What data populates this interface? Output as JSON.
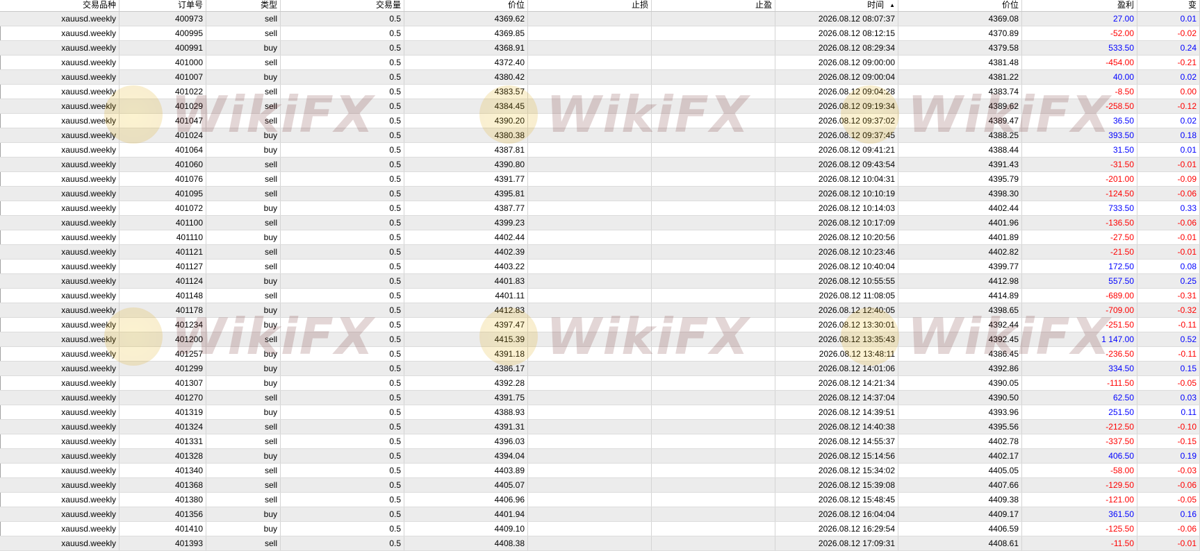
{
  "columns": [
    {
      "key": "symbol",
      "label": "交易品种"
    },
    {
      "key": "order",
      "label": "订单号"
    },
    {
      "key": "type",
      "label": "类型"
    },
    {
      "key": "volume",
      "label": "交易量"
    },
    {
      "key": "price_open",
      "label": "价位"
    },
    {
      "key": "sl",
      "label": "止损"
    },
    {
      "key": "tp",
      "label": "止盈"
    },
    {
      "key": "time",
      "label": "时间",
      "sorted": "ascending"
    },
    {
      "key": "price_close",
      "label": "价位"
    },
    {
      "key": "profit",
      "label": "盈利"
    },
    {
      "key": "change",
      "label": "变"
    }
  ],
  "sort_icon": "sort-ascending-icon",
  "colors": {
    "positive": "#0000ff",
    "negative": "#ff0000",
    "alt_row": "#ececec"
  },
  "watermark": {
    "text": "WikiFX",
    "icon": "wikifx-seal-icon"
  },
  "rows": [
    [
      "xauusd.weekly",
      "400973",
      "sell",
      "0.5",
      "4369.62",
      "",
      "",
      "2026.08.12 08:07:37",
      "4369.08",
      "27.00",
      "0.01"
    ],
    [
      "xauusd.weekly",
      "400995",
      "sell",
      "0.5",
      "4369.85",
      "",
      "",
      "2026.08.12 08:12:15",
      "4370.89",
      "-52.00",
      "-0.02"
    ],
    [
      "xauusd.weekly",
      "400991",
      "buy",
      "0.5",
      "4368.91",
      "",
      "",
      "2026.08.12 08:29:34",
      "4379.58",
      "533.50",
      "0.24"
    ],
    [
      "xauusd.weekly",
      "401000",
      "sell",
      "0.5",
      "4372.40",
      "",
      "",
      "2026.08.12 09:00:00",
      "4381.48",
      "-454.00",
      "-0.21"
    ],
    [
      "xauusd.weekly",
      "401007",
      "buy",
      "0.5",
      "4380.42",
      "",
      "",
      "2026.08.12 09:00:04",
      "4381.22",
      "40.00",
      "0.02"
    ],
    [
      "xauusd.weekly",
      "401022",
      "sell",
      "0.5",
      "4383.57",
      "",
      "",
      "2026.08.12 09:04:28",
      "4383.74",
      "-8.50",
      "0.00"
    ],
    [
      "xauusd.weekly",
      "401029",
      "sell",
      "0.5",
      "4384.45",
      "",
      "",
      "2026.08.12 09:19:34",
      "4389.62",
      "-258.50",
      "-0.12"
    ],
    [
      "xauusd.weekly",
      "401047",
      "sell",
      "0.5",
      "4390.20",
      "",
      "",
      "2026.08.12 09:37:02",
      "4389.47",
      "36.50",
      "0.02"
    ],
    [
      "xauusd.weekly",
      "401024",
      "buy",
      "0.5",
      "4380.38",
      "",
      "",
      "2026.08.12 09:37:45",
      "4388.25",
      "393.50",
      "0.18"
    ],
    [
      "xauusd.weekly",
      "401064",
      "buy",
      "0.5",
      "4387.81",
      "",
      "",
      "2026.08.12 09:41:21",
      "4388.44",
      "31.50",
      "0.01"
    ],
    [
      "xauusd.weekly",
      "401060",
      "sell",
      "0.5",
      "4390.80",
      "",
      "",
      "2026.08.12 09:43:54",
      "4391.43",
      "-31.50",
      "-0.01"
    ],
    [
      "xauusd.weekly",
      "401076",
      "sell",
      "0.5",
      "4391.77",
      "",
      "",
      "2026.08.12 10:04:31",
      "4395.79",
      "-201.00",
      "-0.09"
    ],
    [
      "xauusd.weekly",
      "401095",
      "sell",
      "0.5",
      "4395.81",
      "",
      "",
      "2026.08.12 10:10:19",
      "4398.30",
      "-124.50",
      "-0.06"
    ],
    [
      "xauusd.weekly",
      "401072",
      "buy",
      "0.5",
      "4387.77",
      "",
      "",
      "2026.08.12 10:14:03",
      "4402.44",
      "733.50",
      "0.33"
    ],
    [
      "xauusd.weekly",
      "401100",
      "sell",
      "0.5",
      "4399.23",
      "",
      "",
      "2026.08.12 10:17:09",
      "4401.96",
      "-136.50",
      "-0.06"
    ],
    [
      "xauusd.weekly",
      "401110",
      "buy",
      "0.5",
      "4402.44",
      "",
      "",
      "2026.08.12 10:20:56",
      "4401.89",
      "-27.50",
      "-0.01"
    ],
    [
      "xauusd.weekly",
      "401121",
      "sell",
      "0.5",
      "4402.39",
      "",
      "",
      "2026.08.12 10:23:46",
      "4402.82",
      "-21.50",
      "-0.01"
    ],
    [
      "xauusd.weekly",
      "401127",
      "sell",
      "0.5",
      "4403.22",
      "",
      "",
      "2026.08.12 10:40:04",
      "4399.77",
      "172.50",
      "0.08"
    ],
    [
      "xauusd.weekly",
      "401124",
      "buy",
      "0.5",
      "4401.83",
      "",
      "",
      "2026.08.12 10:55:55",
      "4412.98",
      "557.50",
      "0.25"
    ],
    [
      "xauusd.weekly",
      "401148",
      "sell",
      "0.5",
      "4401.11",
      "",
      "",
      "2026.08.12 11:08:05",
      "4414.89",
      "-689.00",
      "-0.31"
    ],
    [
      "xauusd.weekly",
      "401178",
      "buy",
      "0.5",
      "4412.83",
      "",
      "",
      "2026.08.12 12:40:05",
      "4398.65",
      "-709.00",
      "-0.32"
    ],
    [
      "xauusd.weekly",
      "401234",
      "buy",
      "0.5",
      "4397.47",
      "",
      "",
      "2026.08.12 13:30:01",
      "4392.44",
      "-251.50",
      "-0.11"
    ],
    [
      "xauusd.weekly",
      "401200",
      "sell",
      "0.5",
      "4415.39",
      "",
      "",
      "2026.08.12 13:35:43",
      "4392.45",
      "1 147.00",
      "0.52"
    ],
    [
      "xauusd.weekly",
      "401257",
      "buy",
      "0.5",
      "4391.18",
      "",
      "",
      "2026.08.12 13:48:11",
      "4386.45",
      "-236.50",
      "-0.11"
    ],
    [
      "xauusd.weekly",
      "401299",
      "buy",
      "0.5",
      "4386.17",
      "",
      "",
      "2026.08.12 14:01:06",
      "4392.86",
      "334.50",
      "0.15"
    ],
    [
      "xauusd.weekly",
      "401307",
      "buy",
      "0.5",
      "4392.28",
      "",
      "",
      "2026.08.12 14:21:34",
      "4390.05",
      "-111.50",
      "-0.05"
    ],
    [
      "xauusd.weekly",
      "401270",
      "sell",
      "0.5",
      "4391.75",
      "",
      "",
      "2026.08.12 14:37:04",
      "4390.50",
      "62.50",
      "0.03"
    ],
    [
      "xauusd.weekly",
      "401319",
      "buy",
      "0.5",
      "4388.93",
      "",
      "",
      "2026.08.12 14:39:51",
      "4393.96",
      "251.50",
      "0.11"
    ],
    [
      "xauusd.weekly",
      "401324",
      "sell",
      "0.5",
      "4391.31",
      "",
      "",
      "2026.08.12 14:40:38",
      "4395.56",
      "-212.50",
      "-0.10"
    ],
    [
      "xauusd.weekly",
      "401331",
      "sell",
      "0.5",
      "4396.03",
      "",
      "",
      "2026.08.12 14:55:37",
      "4402.78",
      "-337.50",
      "-0.15"
    ],
    [
      "xauusd.weekly",
      "401328",
      "buy",
      "0.5",
      "4394.04",
      "",
      "",
      "2026.08.12 15:14:56",
      "4402.17",
      "406.50",
      "0.19"
    ],
    [
      "xauusd.weekly",
      "401340",
      "sell",
      "0.5",
      "4403.89",
      "",
      "",
      "2026.08.12 15:34:02",
      "4405.05",
      "-58.00",
      "-0.03"
    ],
    [
      "xauusd.weekly",
      "401368",
      "sell",
      "0.5",
      "4405.07",
      "",
      "",
      "2026.08.12 15:39:08",
      "4407.66",
      "-129.50",
      "-0.06"
    ],
    [
      "xauusd.weekly",
      "401380",
      "sell",
      "0.5",
      "4406.96",
      "",
      "",
      "2026.08.12 15:48:45",
      "4409.38",
      "-121.00",
      "-0.05"
    ],
    [
      "xauusd.weekly",
      "401356",
      "buy",
      "0.5",
      "4401.94",
      "",
      "",
      "2026.08.12 16:04:04",
      "4409.17",
      "361.50",
      "0.16"
    ],
    [
      "xauusd.weekly",
      "401410",
      "buy",
      "0.5",
      "4409.10",
      "",
      "",
      "2026.08.12 16:29:54",
      "4406.59",
      "-125.50",
      "-0.06"
    ],
    [
      "xauusd.weekly",
      "401393",
      "sell",
      "0.5",
      "4408.38",
      "",
      "",
      "2026.08.12 17:09:31",
      "4408.61",
      "-11.50",
      "-0.01"
    ]
  ]
}
